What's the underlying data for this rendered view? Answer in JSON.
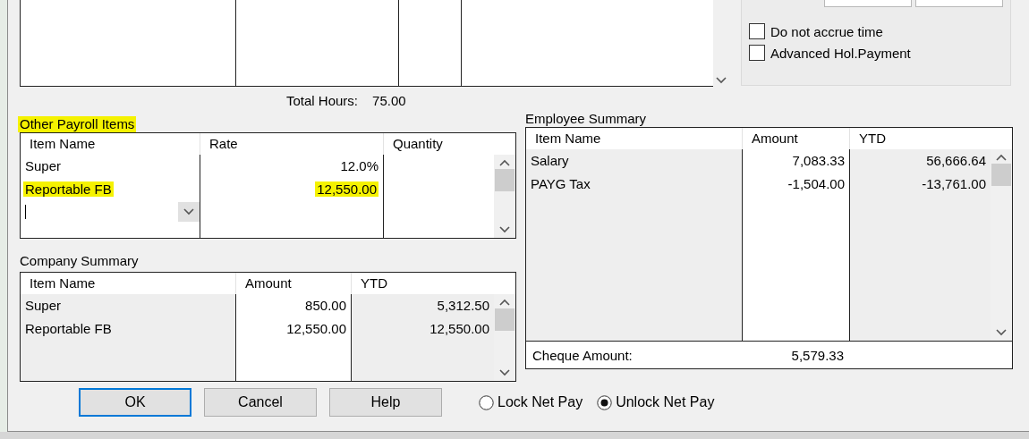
{
  "options": [
    {
      "label": "Do not accrue time",
      "checked": false
    },
    {
      "label": "Advanced Hol.Payment",
      "checked": false
    }
  ],
  "total_hours": {
    "label": "Total Hours:",
    "value": "75.00"
  },
  "other_payroll_items": {
    "title": "Other Payroll Items",
    "highlighted": true,
    "columns": [
      {
        "label": "Item Name",
        "numeric": false,
        "shaded": false
      },
      {
        "label": "Rate",
        "numeric": true,
        "shaded": false
      },
      {
        "label": "Quantity",
        "shaded": false
      }
    ],
    "rows": [
      {
        "cells": [
          {
            "text": "Super",
            "highlighted": false
          },
          {
            "text": "12.0%",
            "highlighted": false
          }
        ]
      },
      {
        "cells": [
          {
            "text": "Reportable FB",
            "highlighted": true
          },
          {
            "text": "12,550.00",
            "highlighted": true
          }
        ]
      }
    ],
    "entry": {
      "kind": "combo"
    }
  },
  "company_summary": {
    "title": "Company Summary",
    "columns": [
      {
        "label": "Item Name",
        "numeric": false,
        "shaded": true
      },
      {
        "label": "Amount",
        "numeric": true,
        "shaded": false
      },
      {
        "label": "YTD",
        "numeric": true,
        "shaded": true
      }
    ],
    "rows": [
      [
        "Super",
        "850.00",
        "5,312.50"
      ],
      [
        "Reportable FB",
        "12,550.00",
        "12,550.00"
      ]
    ]
  },
  "employee_summary": {
    "title": "Employee Summary",
    "columns": [
      {
        "label": "Item Name",
        "numeric": false,
        "shaded": true
      },
      {
        "label": "Amount",
        "numeric": true,
        "shaded": false
      },
      {
        "label": "YTD",
        "numeric": true,
        "shaded": true
      }
    ],
    "rows": [
      [
        "Salary",
        "7,083.33",
        "56,666.64"
      ],
      [
        "PAYG Tax",
        "-1,504.00",
        "-13,761.00"
      ]
    ],
    "footer": {
      "label": "Cheque Amount:",
      "value": "5,579.33"
    }
  },
  "buttons": [
    {
      "label": "OK",
      "default": true
    },
    {
      "label": "Cancel",
      "default": false
    },
    {
      "label": "Help",
      "default": false
    }
  ],
  "net_pay": [
    {
      "label": "Lock Net Pay",
      "selected": false
    },
    {
      "label": "Unlock Net Pay",
      "selected": true
    }
  ]
}
